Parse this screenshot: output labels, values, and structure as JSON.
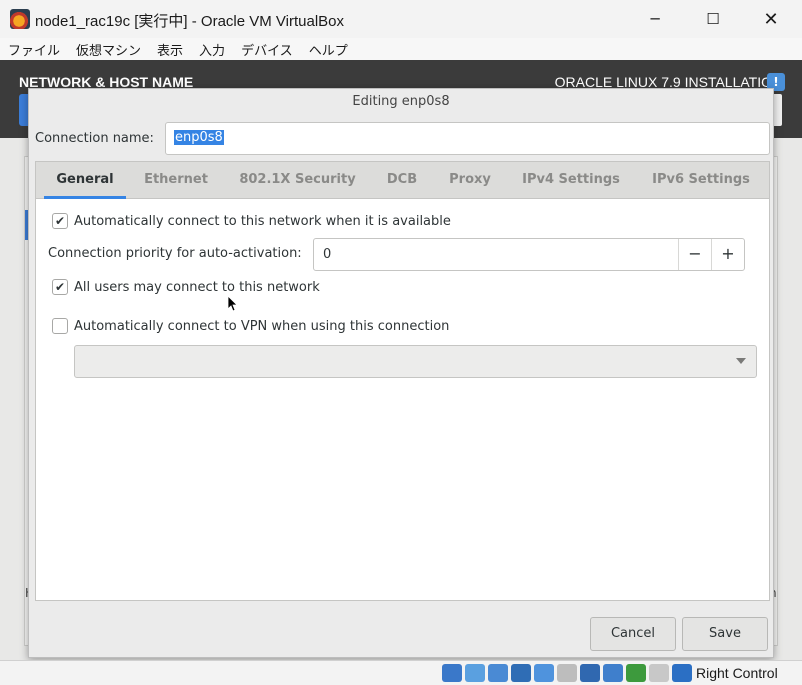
{
  "window": {
    "title": "node1_rac19c [実行中] - Oracle VM VirtualBox",
    "minimize_glyph": "─",
    "maximize_glyph": "☐",
    "close_glyph": "✕"
  },
  "menubar": {
    "items": [
      "ファイル",
      "仮想マシン",
      "表示",
      "入力",
      "デバイス",
      "ヘルプ"
    ]
  },
  "guest": {
    "spoke_title": "NETWORK & HOST NAME",
    "install_title": "ORACLE LINUX 7.9 INSTALLATIO",
    "help_glyph": "!",
    "bg_fragment_left": "H",
    "bg_fragment_right": "n"
  },
  "dialog": {
    "title": "Editing enp0s8",
    "connection_name_label": "Connection name:",
    "connection_name_value": "enp0s8",
    "tabs": [
      "General",
      "Ethernet",
      "802.1X Security",
      "DCB",
      "Proxy",
      "IPv4 Settings",
      "IPv6 Settings"
    ],
    "active_tab": "General",
    "general": {
      "autoconnect_label": "Automatically connect to this network when it is available",
      "autoconnect_checked": true,
      "priority_label": "Connection priority for auto-activation:",
      "priority_value": "0",
      "priority_minus": "−",
      "priority_plus": "+",
      "all_users_label": "All users may connect to this network",
      "all_users_checked": true,
      "vpn_label": "Automatically connect to VPN when using this connection",
      "vpn_checked": false,
      "vpn_selected": ""
    },
    "cancel_label": "Cancel",
    "save_label": "Save",
    "check_glyph": "✔"
  },
  "statusbar": {
    "host_key": "Right Control",
    "icons": [
      {
        "name": "hard-disk-icon",
        "color": "#3a78c9"
      },
      {
        "name": "optical-drive-icon",
        "color": "#5aa0e0"
      },
      {
        "name": "audio-icon",
        "color": "#4a8ad4"
      },
      {
        "name": "network-icon",
        "color": "#2f6db5"
      },
      {
        "name": "usb-icon",
        "color": "#4f93dd"
      },
      {
        "name": "shared-folders-icon",
        "color": "#bdbdbd"
      },
      {
        "name": "display-icon",
        "color": "#3068b0"
      },
      {
        "name": "recording-icon",
        "color": "#3f7fcc"
      },
      {
        "name": "features-icon",
        "color": "#3d9a3d"
      },
      {
        "name": "mouse-integration-icon",
        "color": "#c8c8c8"
      },
      {
        "name": "keyboard-capture-icon",
        "color": "#2b6fc4"
      }
    ]
  },
  "colors": {
    "accent": "#3584e4",
    "guest_header": "#3b3b3b"
  }
}
